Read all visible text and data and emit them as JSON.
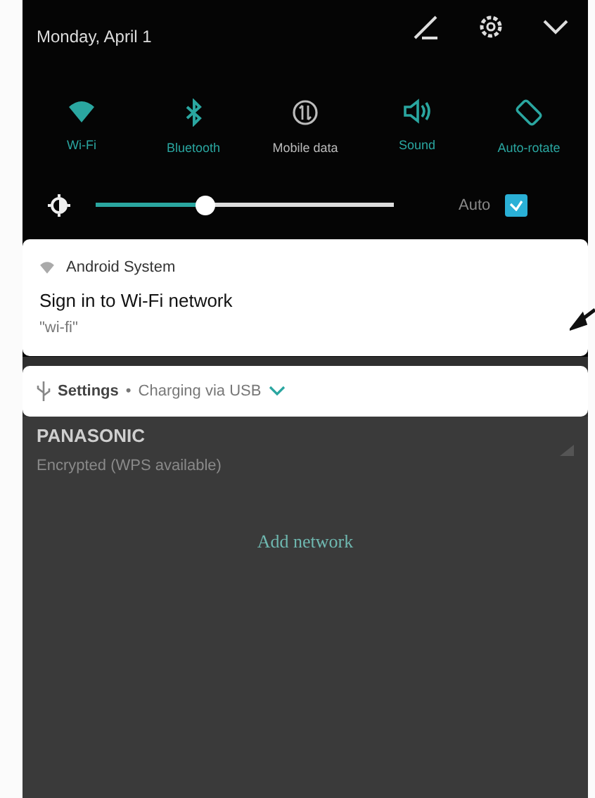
{
  "header": {
    "date": "Monday, April 1"
  },
  "quick_settings": [
    {
      "kind": "wifi",
      "label": "Wi-Fi",
      "on": true
    },
    {
      "kind": "bluetooth",
      "label": "Bluetooth",
      "on": true
    },
    {
      "kind": "data",
      "label": "Mobile data",
      "on": false
    },
    {
      "kind": "sound",
      "label": "Sound",
      "on": true
    },
    {
      "kind": "rotate",
      "label": "Auto-rotate",
      "on": true
    }
  ],
  "brightness": {
    "level": 0.37,
    "auto_label": "Auto",
    "auto_checked": true
  },
  "notifications": [
    {
      "kind": "full",
      "app": "Android System",
      "title": "Sign in to Wi-Fi network",
      "text": "\"wi-fi\""
    },
    {
      "kind": "compact",
      "app": "Settings",
      "separator": "•",
      "text": "Charging via USB"
    }
  ],
  "background": {
    "network_name": "PANASONIC",
    "network_status": "Encrypted (WPS available)",
    "add_button": "Add network"
  }
}
